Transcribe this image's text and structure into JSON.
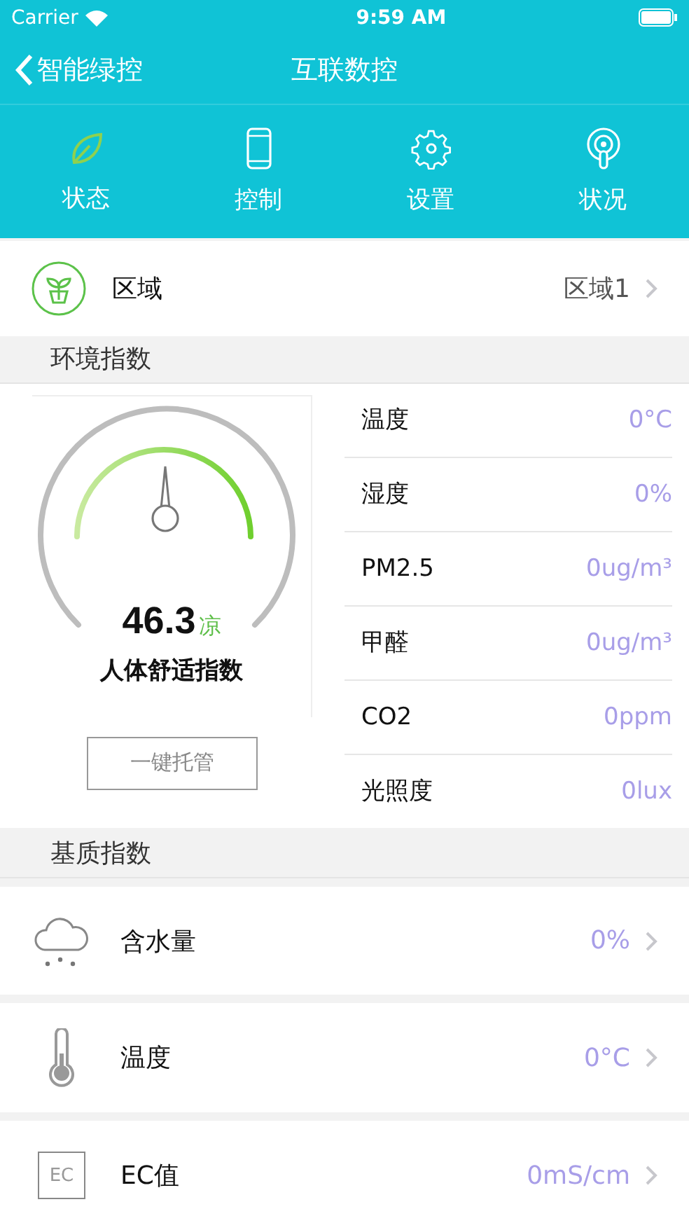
{
  "status_bar": {
    "carrier": "Carrier",
    "time": "9:59 AM"
  },
  "nav": {
    "back_label": "智能绿控",
    "title": "互联数控"
  },
  "tabs": [
    {
      "label": "状态",
      "kind": "leaf",
      "selected": true
    },
    {
      "label": "控制",
      "kind": "phone",
      "selected": false
    },
    {
      "label": "设置",
      "kind": "gear",
      "selected": false
    },
    {
      "label": "状况",
      "kind": "signal",
      "selected": false
    }
  ],
  "zone": {
    "label": "区域",
    "value": "区域1"
  },
  "environment": {
    "header": "环境指数",
    "gauge": {
      "value": "46.3",
      "rating": "凉",
      "caption": "人体舒适指数"
    },
    "button": "一键托管",
    "readings": [
      {
        "name": "温度",
        "value": "0°C"
      },
      {
        "name": "湿度",
        "value": "0%"
      },
      {
        "name": "PM2.5",
        "value": "0ug/m³"
      },
      {
        "name": "甲醛",
        "value": "0ug/m³"
      },
      {
        "name": "CO2",
        "value": "0ppm"
      },
      {
        "name": "光照度",
        "value": "0lux"
      }
    ]
  },
  "substrate": {
    "header": "基质指数",
    "rows": [
      {
        "kind": "cloud",
        "name": "含水量",
        "value": "0%"
      },
      {
        "kind": "thermometer",
        "name": "温度",
        "value": "0°C"
      },
      {
        "kind": "badge",
        "badge": "EC",
        "name": "EC值",
        "value": "0mS/cm"
      }
    ]
  }
}
